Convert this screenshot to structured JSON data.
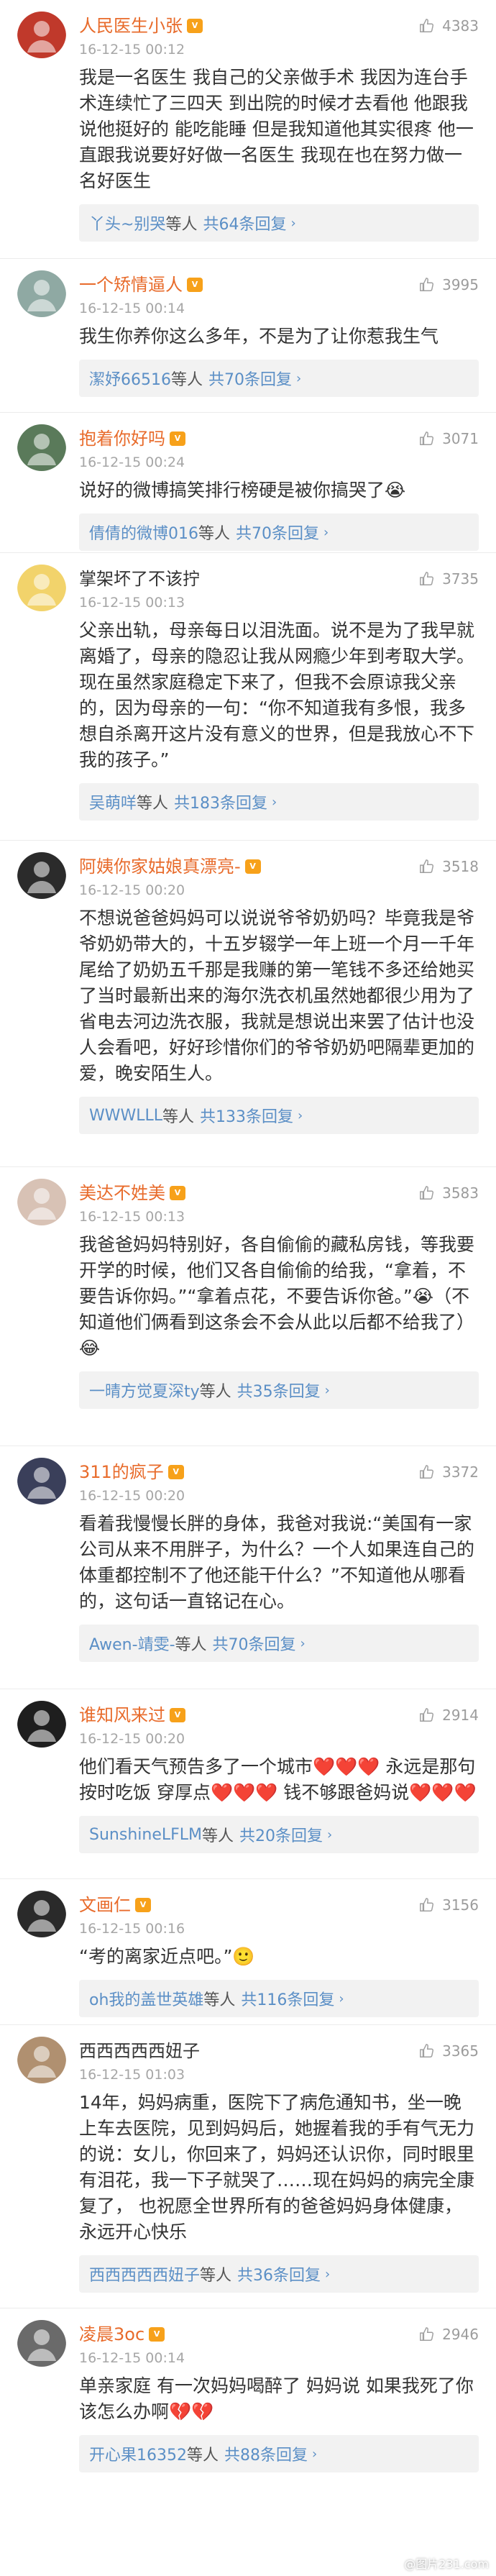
{
  "comments": [
    {
      "user": "人民医生小张",
      "verified": true,
      "name_color": "#e86b2b",
      "avatar_color": "#c0392b",
      "avatar_icon": "doctor-avatar-icon",
      "time": "16-12-15 00:12",
      "likes": "4383",
      "text": "我是一名医生  我自己的父亲做手术 我因为连台手术连续忙了三四天  到出院的时候才去看他  他跟我说他挺好的  能吃能睡  但是我知道他其实很疼  他一直跟我说要好好做一名医生   我现在也在努力做一名好医生",
      "reply_name": "丫头~别哭",
      "reply_mid": "等人",
      "reply_count": "共64条回复",
      "reply_arrow": "›"
    },
    {
      "user": "一个矫情逼人",
      "verified": true,
      "name_color": "#e86b2b",
      "avatar_color": "#8fa9a3",
      "avatar_icon": "person-avatar-icon",
      "time": "16-12-15 00:14",
      "likes": "3995",
      "text": "我生你养你这么多年，不是为了让你惹我生气",
      "reply_name": "潔妤66516",
      "reply_mid": "等人",
      "reply_count": "共70条回复",
      "reply_arrow": "›"
    },
    {
      "user": "抱着你好吗",
      "verified": true,
      "name_color": "#e86b2b",
      "avatar_color": "#5a7a5a",
      "avatar_icon": "person-avatar-icon",
      "time": "16-12-15 00:24",
      "likes": "3071",
      "text": "说好的微博搞笑排行榜硬是被你搞哭了😭",
      "reply_name": "倩倩的微博016",
      "reply_mid": "等人",
      "reply_count": "共70条回复",
      "reply_arrow": "›"
    },
    {
      "user": "掌架坏了不该拧",
      "verified": false,
      "name_color": "#333333",
      "avatar_color": "#f2d36b",
      "avatar_icon": "cartoon-avatar-icon",
      "time": "16-12-15 00:13",
      "likes": "3735",
      "text": "父亲出轨，母亲每日以泪洗面。说不是为了我早就离婚了，母亲的隐忍让我从网瘾少年到考取大学。现在虽然家庭稳定下来了，但我不会原谅我父亲的，因为母亲的一句：“你不知道我有多恨，我多想自杀离开这片没有意义的世界，但是我放心不下我的孩子。”",
      "reply_name": "吴萌咩",
      "reply_mid": "等人",
      "reply_count": "共183条回复",
      "reply_arrow": "›"
    },
    {
      "user": "阿姨你家姑娘真漂亮-",
      "verified": true,
      "name_color": "#e86b2b",
      "avatar_color": "#2b2b2b",
      "avatar_icon": "panda-avatar-icon",
      "time": "16-12-15 00:20",
      "likes": "3518",
      "text": "不想说爸爸妈妈可以说说爷爷奶奶吗？毕竟我是爷爷奶奶带大的，十五岁辍学一年上班一个月一千年尾给了奶奶五千那是我赚的第一笔钱不多还给她买了当时最新出来的海尔洗衣机虽然她都很少用为了省电去河边洗衣服，我就是想说出来罢了估计也没人会看吧，好好珍惜你们的爷爷奶奶吧隔辈更加的爱，晚安陌生人。",
      "reply_name": "WWWLLL",
      "reply_mid": "等人",
      "reply_count": "共133条回复",
      "reply_arrow": "›"
    },
    {
      "user": "美达不姓美",
      "verified": true,
      "name_color": "#e86b2b",
      "avatar_color": "#d8c2b5",
      "avatar_icon": "person-avatar-icon",
      "time": "16-12-15 00:13",
      "likes": "3583",
      "text": "我爸爸妈妈特别好，各自偷偷的藏私房钱，等我要开学的时候，他们又各自偷偷的给我，“拿着，不要告诉你妈。”“拿着点花，不要告诉你爸。”😭（不知道他们俩看到这条会不会从此以后都不给我了）😂",
      "reply_name": "一晴方觉夏深ty",
      "reply_mid": "等人",
      "reply_count": "共35条回复",
      "reply_arrow": "›"
    },
    {
      "user": "311的疯子",
      "verified": true,
      "name_color": "#e86b2b",
      "avatar_color": "#3a3f5a",
      "avatar_icon": "person-avatar-icon",
      "time": "16-12-15 00:20",
      "likes": "3372",
      "text": "看着我慢慢长胖的身体，我爸对我说:“美国有一家公司从来不用胖子，为什么？一个人如果连自己的体重都控制不了他还能干什么？”不知道他从哪看的，这句话一直铭记在心。",
      "reply_name": "Awen-靖雯-",
      "reply_mid": "等人",
      "reply_count": "共70条回复",
      "reply_arrow": "›"
    },
    {
      "user": "谁知风来过",
      "verified": true,
      "name_color": "#e86b2b",
      "avatar_color": "#1e1e1e",
      "avatar_icon": "person-avatar-icon",
      "time": "16-12-15 00:20",
      "likes": "2914",
      "text": "他们看天气预告多了一个城市❤️❤️❤️  永远是那句按时吃饭  穿厚点❤️❤️❤️  钱不够跟爸妈说❤️❤️❤️",
      "reply_name": "SunshineLFLM",
      "reply_mid": "等人",
      "reply_count": "共20条回复",
      "reply_arrow": "›"
    },
    {
      "user": "文画仁",
      "verified": true,
      "name_color": "#e86b2b",
      "avatar_color": "#2a2a2a",
      "avatar_icon": "person-avatar-icon",
      "time": "16-12-15 00:16",
      "likes": "3156",
      "text": "“考的离家近点吧。”🙂",
      "reply_name": "oh我的盖世英雄",
      "reply_mid": "等人",
      "reply_count": "共116条回复",
      "reply_arrow": "›"
    },
    {
      "user": "西西西西西妞子",
      "verified": false,
      "name_color": "#333333",
      "avatar_color": "#b09070",
      "avatar_icon": "person-avatar-icon",
      "time": "16-12-15 01:03",
      "likes": "3365",
      "text": "14年，妈妈病重，医院下了病危通知书，坐一晚上车去医院，见到妈妈后，她握着我的手有气无力的说：女儿，你回来了，妈妈还认识你，同时眼里有泪花，我一下子就哭了……现在妈妈的病完全康复了，                         也祝愿全世界所有的爸爸妈妈身体健康，永远开心快乐",
      "reply_name": "西西西西西妞子",
      "reply_mid": "等人",
      "reply_count": "共36条回复",
      "reply_arrow": "›"
    },
    {
      "user": "凌晨3oc",
      "verified": true,
      "name_color": "#e86b2b",
      "avatar_color": "#6a6a6a",
      "avatar_icon": "person-avatar-icon",
      "time": "16-12-15 00:14",
      "likes": "2946",
      "text": "单亲家庭 有一次妈妈喝醉了 妈妈说 如果我死了你该怎么办啊💔💔",
      "reply_name": "开心果16352",
      "reply_mid": "等人",
      "reply_count": "共88条回复",
      "reply_arrow": "›"
    }
  ],
  "watermark": "@图片231.com"
}
